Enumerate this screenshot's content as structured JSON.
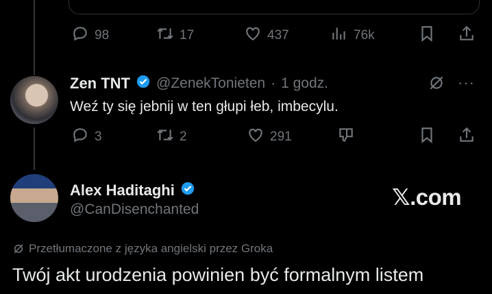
{
  "colors": {
    "background": "#000000",
    "text": "#e7e9ea",
    "muted": "#71767b",
    "verified": "#1d9bf0",
    "line": "#333639"
  },
  "tweet_top": {
    "actions": {
      "replies": "98",
      "retweets": "17",
      "likes": "437",
      "views": "76k"
    }
  },
  "tweet_reply": {
    "name": "Zen TNT",
    "handle": "@ZenekTonieten",
    "separator": "·",
    "time": "1 godz.",
    "text": "Weź ty się jebnij w ten głupi łeb, imbecylu.",
    "actions": {
      "replies": "3",
      "retweets": "2",
      "likes": "291"
    }
  },
  "tweet_main": {
    "name": "Alex Haditaghi",
    "handle": "@CanDisenchanted",
    "brand": "𝕏.com",
    "translated_note": "Przetłumaczone z języka angielski przez Groka",
    "text": "Twój akt urodzenia powinien być formalnym listem"
  },
  "icons": [
    "reply-icon",
    "retweet-icon",
    "like-icon",
    "views-icon",
    "bookmark-icon",
    "share-icon",
    "grok-icon",
    "more-icon",
    "dislike-icon",
    "verified-icon"
  ]
}
